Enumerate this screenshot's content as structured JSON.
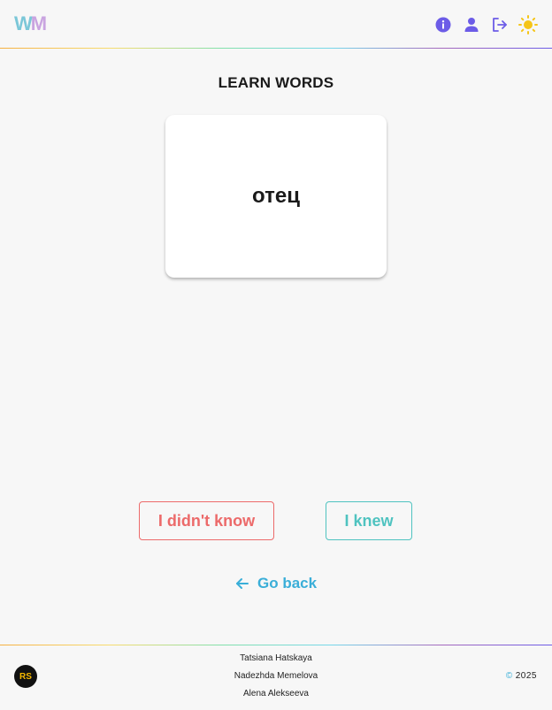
{
  "header": {
    "logo_w": "W",
    "logo_m": "M",
    "icons": [
      "info-icon",
      "user-icon",
      "logout-icon",
      "sun-icon"
    ]
  },
  "main": {
    "title": "LEARN WORDS",
    "card_word": "отец",
    "didnt_know_label": "I didn't know",
    "knew_label": "I knew",
    "go_back_label": "Go back"
  },
  "footer": {
    "rs_logo": "RS",
    "authors": [
      "Tatsiana Hatskaya",
      "Nadezhda Memelova",
      "Alena Alekseeva"
    ],
    "copyright_symbol": "©",
    "year": "2025"
  },
  "colors": {
    "accent_purple": "#6c5ce7",
    "sun_yellow": "#f5c518",
    "didnt_know_red": "#ec6a6a",
    "knew_teal": "#4fc3c0",
    "go_back_blue": "#3aaed8"
  }
}
